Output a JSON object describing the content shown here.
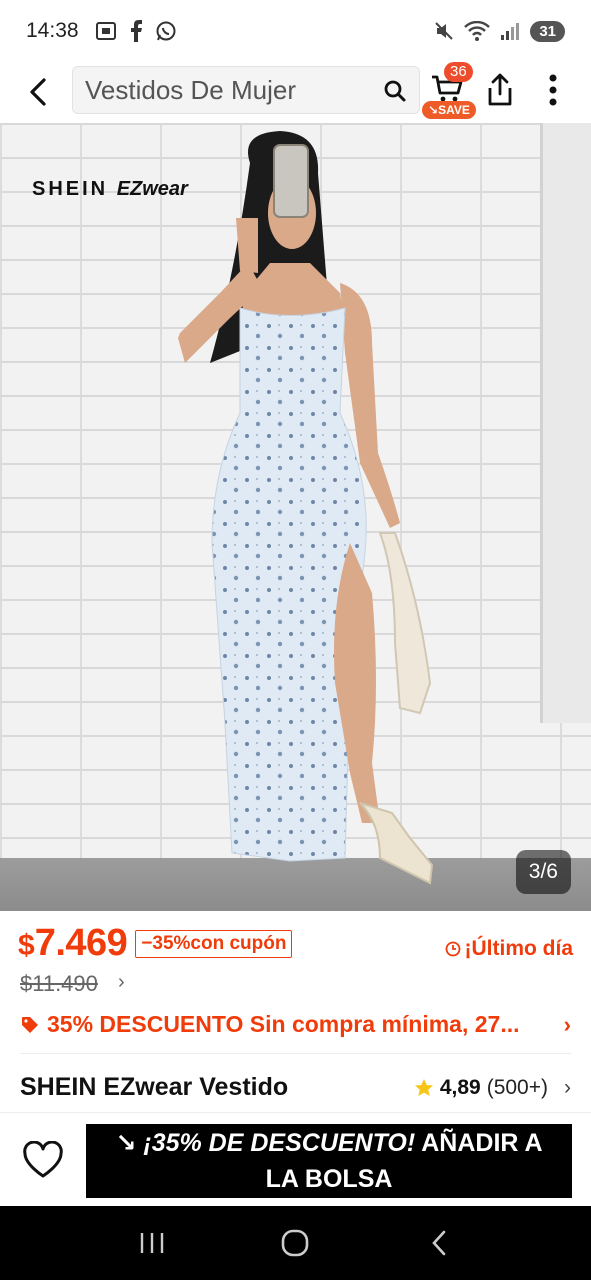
{
  "status_bar": {
    "time": "14:38",
    "left_icons": [
      "screenshot-icon",
      "facebook-icon",
      "whatsapp-icon"
    ],
    "right_icons": [
      "mute-icon",
      "wifi-icon",
      "signal-icon"
    ],
    "battery": "31"
  },
  "header": {
    "search_text": "Vestidos De Mujer",
    "cart_count": "36",
    "save_label": "SAVE"
  },
  "product_image": {
    "brand_logo_main": "SHEIN",
    "brand_logo_sub": "EZwear",
    "counter": "3/6"
  },
  "price": {
    "currency_symbol": "$",
    "current": "7.469",
    "coupon": "−35%con cupón",
    "original": "$11.490",
    "last_day": "¡Último día"
  },
  "promo": {
    "text": "35% DESCUENTO Sin compra mínima,  27..."
  },
  "product": {
    "title": "SHEIN EZwear Vestido",
    "rating": "4,89",
    "reviews": "(500+)"
  },
  "action_bar": {
    "add_promo": "¡35% DE DESCUENTO!",
    "add_label": "AÑADIR A LA BOLSA"
  },
  "colors": {
    "accent": "#f03c0a",
    "button_bg": "#000000",
    "star": "#f5c518"
  }
}
